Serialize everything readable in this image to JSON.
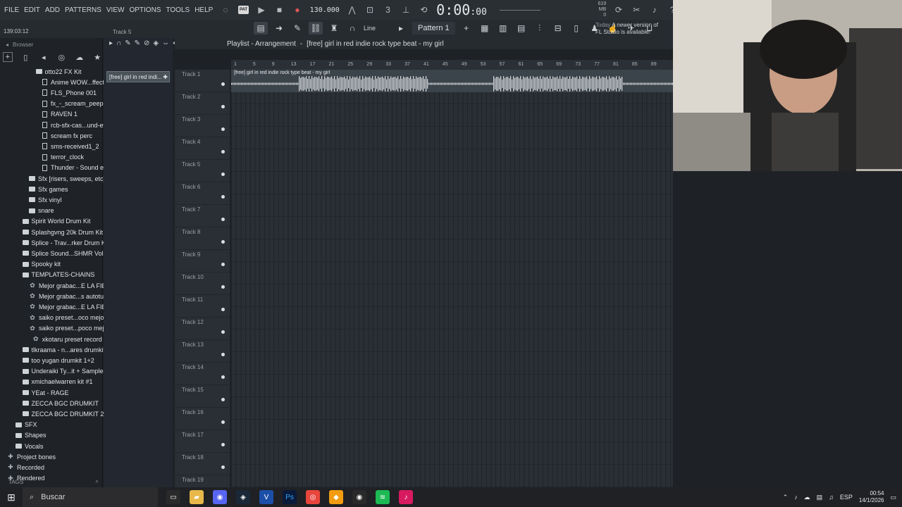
{
  "menu": [
    "FILE",
    "EDIT",
    "ADD",
    "PATTERNS",
    "VIEW",
    "OPTIONS",
    "TOOLS",
    "HELP"
  ],
  "transport": {
    "pat_badge": "PAT",
    "bpm": "130.000",
    "time": "0:00",
    "time_small": ":00",
    "memory": "619 MB",
    "cpu_label": "4",
    "voices": "0"
  },
  "hint_time": "139:03:12",
  "track_label_top": "Track 5",
  "tools": {
    "line_label": "Line",
    "pattern": "Pattern 1"
  },
  "news": {
    "today": "Today",
    "line1": "A newer version of",
    "line2": "FL Studio is available!"
  },
  "browser": {
    "title": "Browser",
    "items": [
      {
        "label": "otto22 FX Kit",
        "type": "folder",
        "depth": 3
      },
      {
        "label": "Anime WOW...ffect (HD)",
        "type": "file",
        "depth": 4
      },
      {
        "label": "FLS_Phone 001",
        "type": "file",
        "depth": 4
      },
      {
        "label": "fx_-_scream_peep",
        "type": "file",
        "depth": 4
      },
      {
        "label": "RAVEN 1",
        "type": "file",
        "depth": 4
      },
      {
        "label": "rcb-sfx-cas...und-effects",
        "type": "file",
        "depth": 4
      },
      {
        "label": "scream fx perc",
        "type": "file",
        "depth": 4
      },
      {
        "label": "sms-received1_2",
        "type": "file",
        "depth": 4
      },
      {
        "label": "terror_clock",
        "type": "file",
        "depth": 4
      },
      {
        "label": "Thunder - Sound effect",
        "type": "file",
        "depth": 4
      },
      {
        "label": "Sfx [risers, sweeps, etc]",
        "type": "folder",
        "depth": 2
      },
      {
        "label": "Sfx games",
        "type": "folder",
        "depth": 2
      },
      {
        "label": "Sfx vinyl",
        "type": "folder",
        "depth": 2
      },
      {
        "label": "snare",
        "type": "folder",
        "depth": 2
      },
      {
        "label": "Spirit World Drum Kit",
        "type": "folder",
        "depth": 1
      },
      {
        "label": "Splashgvng 20k Drum Kit",
        "type": "folder",
        "depth": 1
      },
      {
        "label": "Splice - Trav...rker Drum Kit",
        "type": "folder",
        "depth": 1
      },
      {
        "label": "Splice Sound...SHMR Vol. 3",
        "type": "folder",
        "depth": 1
      },
      {
        "label": "Spooky kit",
        "type": "folder",
        "depth": 1
      },
      {
        "label": "TEMPLATES-CHAINS",
        "type": "folder",
        "depth": 1
      },
      {
        "label": "Mejor grabac...E LA FIESTA",
        "type": "preset",
        "depth": 2
      },
      {
        "label": "Mejor grabac...s autotune)",
        "type": "preset",
        "depth": 2
      },
      {
        "label": "Mejor grabac...E LA FIESTA",
        "type": "preset",
        "depth": 2
      },
      {
        "label": "saiko preset...oco mejor v2",
        "type": "preset",
        "depth": 2
      },
      {
        "label": "saiko preset...poco mejor",
        "type": "preset",
        "depth": 2
      },
      {
        "label": "xkotaru preset record",
        "type": "preset",
        "depth": 2.5
      },
      {
        "label": "tlkraama - n...ares drumkit",
        "type": "folder",
        "depth": 1
      },
      {
        "label": "too yugan drumkit 1+2",
        "type": "folder",
        "depth": 1
      },
      {
        "label": "Underaiki Ty...it + Samples",
        "type": "folder",
        "depth": 1
      },
      {
        "label": "xmichaelwarren kit #1",
        "type": "folder",
        "depth": 1
      },
      {
        "label": "YEat - RAGE",
        "type": "folder",
        "depth": 1
      },
      {
        "label": "ZECCA BGC DRUMKIT",
        "type": "folder",
        "depth": 1
      },
      {
        "label": "ZECCA BGC DRUMKIT 2",
        "type": "folder",
        "depth": 1
      },
      {
        "label": "SFX",
        "type": "folder",
        "depth": 0
      },
      {
        "label": "Shapes",
        "type": "folder",
        "depth": 0
      },
      {
        "label": "Vocals",
        "type": "folder",
        "depth": 0
      },
      {
        "label": "Project bones",
        "type": "special",
        "depth": -1
      },
      {
        "label": "Recorded",
        "type": "special",
        "depth": -1
      },
      {
        "label": "Rendered",
        "type": "special",
        "depth": -1
      }
    ],
    "tags": "TAGS"
  },
  "playlist": {
    "title": "Playlist - Arrangement",
    "clip_name": "[free] girl in red  indie rock type beat - my girl",
    "clip_short": "[free] girl in red indi...",
    "ruler": [
      "1",
      "5",
      "9",
      "13",
      "17",
      "21",
      "25",
      "29",
      "33",
      "37",
      "41",
      "45",
      "49",
      "53",
      "57",
      "61",
      "65",
      "69",
      "73",
      "77",
      "81",
      "85",
      "89"
    ],
    "tracks": [
      "Track 1",
      "Track 2",
      "Track 3",
      "Track 4",
      "Track 5",
      "Track 6",
      "Track 7",
      "Track 8",
      "Track 9",
      "Track 10",
      "Track 11",
      "Track 12",
      "Track 13",
      "Track 14",
      "Track 15",
      "Track 16",
      "Track 17",
      "Track 18",
      "Track 19"
    ]
  },
  "taskbar": {
    "search": "Buscar",
    "lang": "ESP",
    "time": "00:54",
    "date": "14/1/2026"
  }
}
